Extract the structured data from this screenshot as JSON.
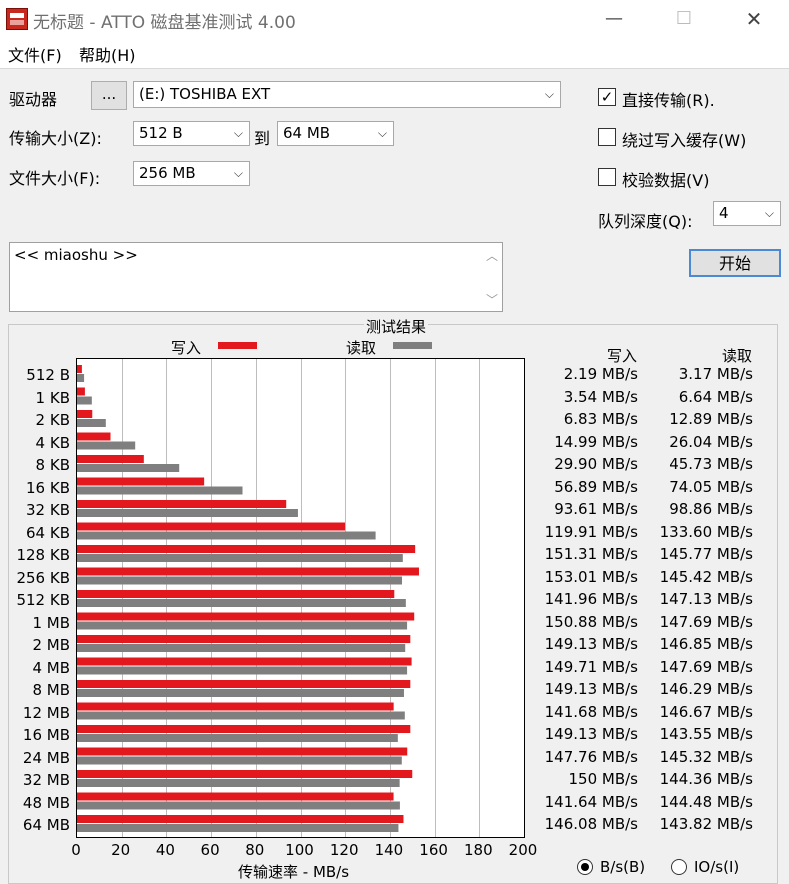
{
  "window": {
    "title": "无标题 - ATTO 磁盘基准测试 4.00",
    "minimize_glyph": "—",
    "maximize_glyph": "☐",
    "close_glyph": "✕"
  },
  "menu": {
    "file": "文件(F)",
    "help": "帮助(H)"
  },
  "controls": {
    "drive_label": "驱动器",
    "browse_label": "...",
    "drive_value": "(E:) TOSHIBA EXT",
    "transfer_size_label": "传输大小(Z):",
    "transfer_from": "512 B",
    "to_label": "到",
    "transfer_to": "64 MB",
    "file_size_label": "文件大小(F):",
    "file_size": "256 MB",
    "direct_io_label": "直接传输(R).",
    "direct_io_checked": true,
    "bypass_cache_label": "绕过写入缓存(W)",
    "bypass_cache_checked": false,
    "verify_label": "校验数据(V)",
    "verify_checked": false,
    "queue_depth_label": "队列深度(Q):",
    "queue_depth": "4",
    "start_label": "开始",
    "description": "<< miaoshu >>"
  },
  "results": {
    "title": "测试结果",
    "write_label": "写入",
    "read_label": "读取",
    "write_col": "写入",
    "read_col": "读取",
    "xlabel": "传输速率 - MB/s",
    "unit_bytes": "B/s(B)",
    "unit_io": "IO/s(I)",
    "unit_selected": "B/s(B)"
  },
  "chart_data": {
    "type": "bar",
    "orientation": "horizontal",
    "xlabel": "传输速率 - MB/s",
    "xlim": [
      0,
      200
    ],
    "xticks": [
      "0",
      "20",
      "40",
      "60",
      "80",
      "100",
      "120",
      "140",
      "160",
      "180",
      "200"
    ],
    "grid": true,
    "colors": {
      "write": "#e3181f",
      "read": "#7f7f7f"
    },
    "categories": [
      "512 B",
      "1 KB",
      "2 KB",
      "4 KB",
      "8 KB",
      "16 KB",
      "32 KB",
      "64 KB",
      "128 KB",
      "256 KB",
      "512 KB",
      "1 MB",
      "2 MB",
      "4 MB",
      "8 MB",
      "12 MB",
      "16 MB",
      "24 MB",
      "32 MB",
      "48 MB",
      "64 MB"
    ],
    "series": [
      {
        "name": "写入",
        "values": [
          2.19,
          3.54,
          6.83,
          14.99,
          29.9,
          56.89,
          93.61,
          119.91,
          151.31,
          153.01,
          141.96,
          150.88,
          149.13,
          149.71,
          149.13,
          141.68,
          149.13,
          147.76,
          150,
          141.64,
          146.08
        ]
      },
      {
        "name": "读取",
        "values": [
          3.17,
          6.64,
          12.89,
          26.04,
          45.73,
          74.05,
          98.86,
          133.6,
          145.77,
          145.42,
          147.13,
          147.69,
          146.85,
          147.69,
          146.29,
          146.67,
          143.55,
          145.32,
          144.36,
          144.48,
          143.82
        ]
      }
    ],
    "write_text": [
      "2.19 MB/s",
      "3.54 MB/s",
      "6.83 MB/s",
      "14.99 MB/s",
      "29.90 MB/s",
      "56.89 MB/s",
      "93.61 MB/s",
      "119.91 MB/s",
      "151.31 MB/s",
      "153.01 MB/s",
      "141.96 MB/s",
      "150.88 MB/s",
      "149.13 MB/s",
      "149.71 MB/s",
      "149.13 MB/s",
      "141.68 MB/s",
      "149.13 MB/s",
      "147.76 MB/s",
      "150 MB/s",
      "141.64 MB/s",
      "146.08 MB/s"
    ],
    "read_text": [
      "3.17 MB/s",
      "6.64 MB/s",
      "12.89 MB/s",
      "26.04 MB/s",
      "45.73 MB/s",
      "74.05 MB/s",
      "98.86 MB/s",
      "133.60 MB/s",
      "145.77 MB/s",
      "145.42 MB/s",
      "147.13 MB/s",
      "147.69 MB/s",
      "146.85 MB/s",
      "147.69 MB/s",
      "146.29 MB/s",
      "146.67 MB/s",
      "143.55 MB/s",
      "145.32 MB/s",
      "144.36 MB/s",
      "144.48 MB/s",
      "143.82 MB/s"
    ]
  }
}
